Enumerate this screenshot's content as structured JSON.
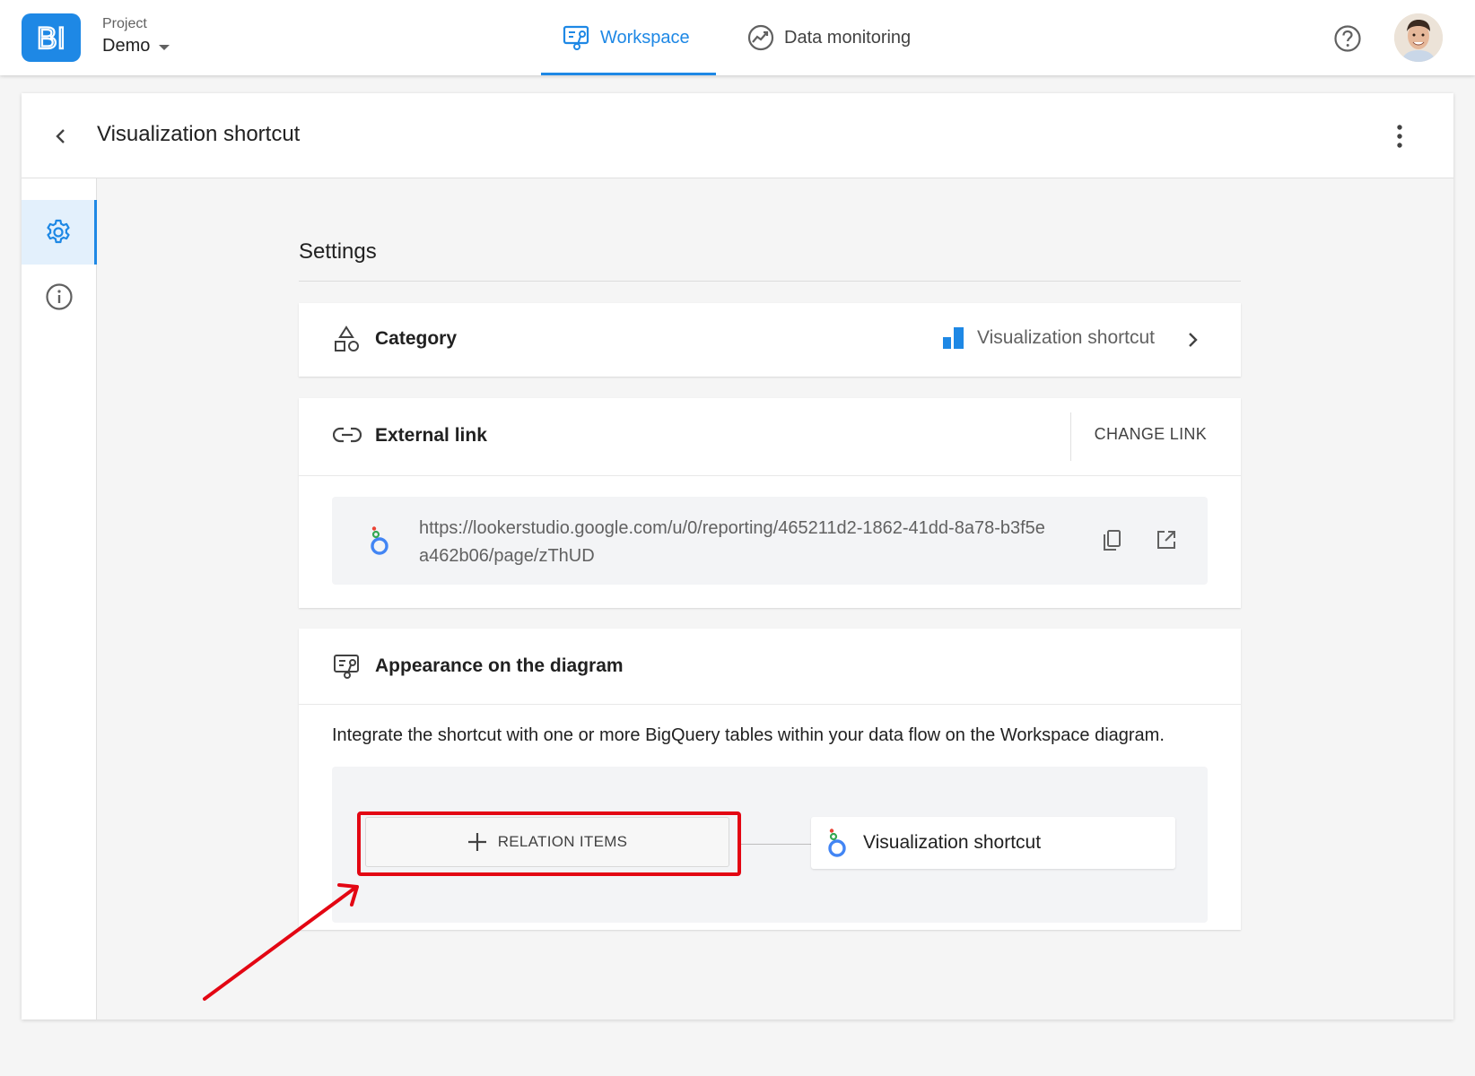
{
  "header": {
    "logo_text": "BI",
    "project_label": "Project",
    "project_value": "Demo",
    "tabs": [
      {
        "label": "Workspace",
        "active": true
      },
      {
        "label": "Data monitoring",
        "active": false
      }
    ]
  },
  "panel": {
    "title": "Visualization shortcut"
  },
  "settings": {
    "title": "Settings",
    "category": {
      "label": "Category",
      "value": "Visualization shortcut"
    },
    "external_link": {
      "label": "External link",
      "action": "CHANGE LINK",
      "url": "https://lookerstudio.google.com/u/0/reporting/465211d2-1862-41dd-8a78-b3f5ea462b06/page/zThUD"
    },
    "appearance": {
      "label": "Appearance on the diagram",
      "description": "Integrate the shortcut with one or more BigQuery tables within your data flow on the Workspace diagram.",
      "relation_button": "RELATION ITEMS",
      "node_label": "Visualization shortcut"
    }
  },
  "colors": {
    "accent": "#1e88e5",
    "highlight": "#e30613"
  }
}
